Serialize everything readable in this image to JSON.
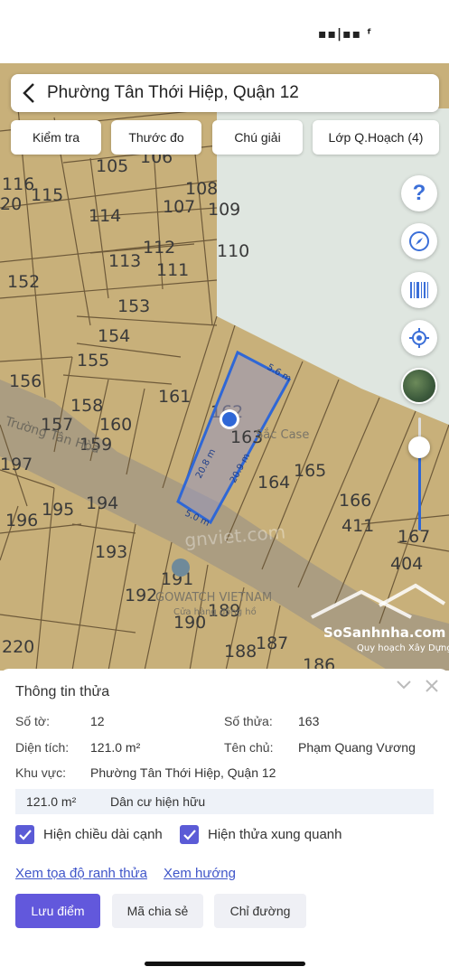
{
  "status": {
    "indicator": "▪▪|▪▪ ᶠ"
  },
  "header": {
    "title": "Phường Tân Thới Hiệp, Quận 12"
  },
  "toolbar": {
    "check": "Kiểm tra",
    "measure": "Thước đo",
    "legend": "Chú giải",
    "layers": "Lớp Q.Hoạch (4)"
  },
  "controls": {
    "help": "?"
  },
  "map": {
    "parcels": [
      "116",
      "115",
      "105",
      "106",
      "108",
      "107",
      "109",
      "114",
      "113",
      "112",
      "111",
      "110",
      "152",
      "153",
      "154",
      "155",
      "156",
      "158",
      "157",
      "161",
      "160",
      "159",
      "162",
      "164",
      "165",
      "166",
      "411",
      "167",
      "404",
      "197",
      "196",
      "195",
      "194",
      "193",
      "191",
      "192",
      "190",
      "189",
      "188",
      "187",
      "186",
      "220",
      "20"
    ],
    "selected_parcel": "163",
    "edge_top": "5.6 m",
    "edge_left": "20.8 m",
    "edge_right": "20.9 m",
    "edge_bottom": "5.0 m",
    "street": "Trường Tân Hòa",
    "poi_1": "Sắc Case",
    "poi_2": "GOWATCH VIETNAM",
    "poi_2_sub": "Cửa hàng đồng hồ",
    "watermark_map": "gnviet.com",
    "brand": "SoSanhnha.com",
    "brand_sub": "Quy hoạch Xây Dựng"
  },
  "panel": {
    "title": "Thông tin thửa",
    "sheet_label": "Số tờ:",
    "sheet_value": "12",
    "parcel_label": "Số thửa:",
    "parcel_value": "163",
    "area_label": "Diện tích:",
    "area_value": "121.0 m²",
    "owner_label": "Tên chủ:",
    "owner_value": "Phạm Quang Vương",
    "region_label": "Khu vực:",
    "region_value": "Phường Tân Thới Hiệp, Quận 12",
    "strip_area": "121.0 m²",
    "strip_use": "Dân cư hiện hữu",
    "check_edges": "Hiện chiều dài cạnh",
    "check_neighbors": "Hiện thửa xung quanh",
    "link_coords": "Xem tọa độ ranh thửa",
    "link_direction": "Xem hướng",
    "btn_save": "Lưu điểm",
    "btn_share": "Mã chia sẻ",
    "btn_route": "Chỉ đường"
  },
  "colors": {
    "parcel_fill": "#c8b07a",
    "parcel_line": "#6e5a3a",
    "road": "#9a8f7a",
    "reserve_zone": "#dfe6e0",
    "accent": "#6258dc",
    "selection": "#2f67d6"
  }
}
